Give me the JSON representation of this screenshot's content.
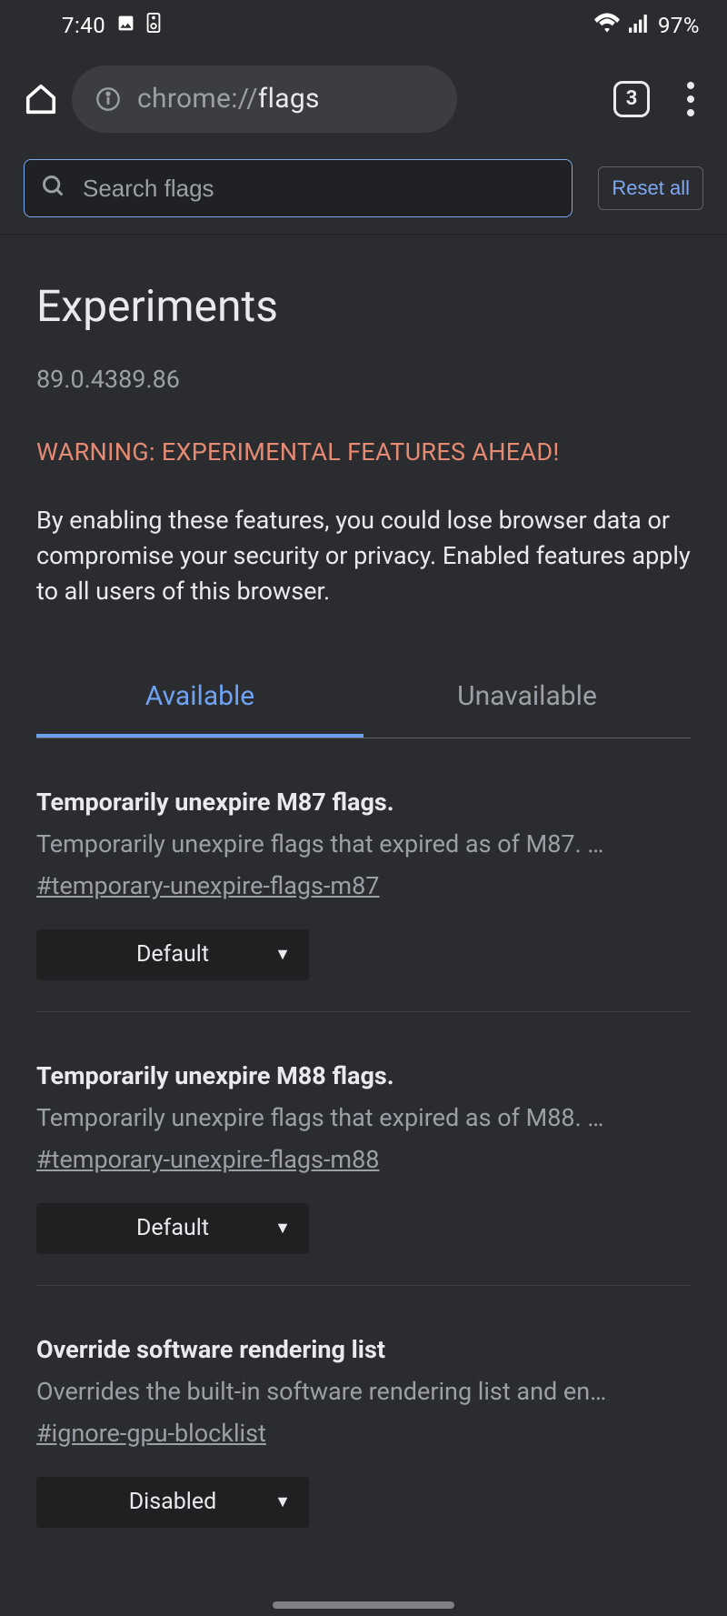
{
  "statusBar": {
    "time": "7:40",
    "battery": "97%"
  },
  "toolbar": {
    "urlScheme": "chrome://",
    "urlHost": "flags",
    "tabCount": "3"
  },
  "searchRow": {
    "placeholder": "Search flags",
    "resetLabel": "Reset all"
  },
  "main": {
    "title": "Experiments",
    "version": "89.0.4389.86",
    "warning": "WARNING: EXPERIMENTAL FEATURES AHEAD!",
    "warningDesc": "By enabling these features, you could lose browser data or compromise your security or privacy. Enabled features apply to all users of this browser."
  },
  "tabs": {
    "available": "Available",
    "unavailable": "Unavailable"
  },
  "flags": [
    {
      "title": "Temporarily unexpire M87 flags.",
      "desc": "Temporarily unexpire flags that expired as of M87. …",
      "anchor": "#temporary-unexpire-flags-m87",
      "value": "Default"
    },
    {
      "title": "Temporarily unexpire M88 flags.",
      "desc": "Temporarily unexpire flags that expired as of M88. …",
      "anchor": "#temporary-unexpire-flags-m88",
      "value": "Default"
    },
    {
      "title": "Override software rendering list",
      "desc": "Overrides the built-in software rendering list and en…",
      "anchor": "#ignore-gpu-blocklist",
      "value": "Disabled"
    }
  ]
}
